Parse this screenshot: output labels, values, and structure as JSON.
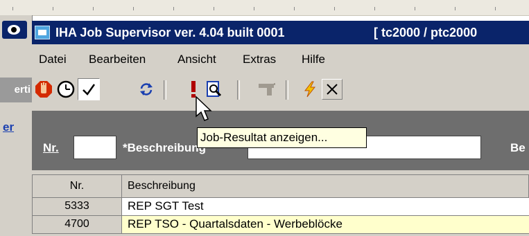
{
  "window": {
    "title": "IHA Job Supervisor ver. 4.04 built 0001",
    "server": "[ tc2000 / ptc2000"
  },
  "side_panel": {
    "gray_label": "erti",
    "link": "er"
  },
  "menu": [
    "Datei",
    "Bearbeiten",
    "Ansicht",
    "Extras",
    "Hilfe"
  ],
  "toolbar": {
    "buttons": [
      {
        "icon": "stop-hand-icon"
      },
      {
        "icon": "clock-icon"
      },
      {
        "icon": "checkmark-icon",
        "pressed": true
      },
      {
        "icon": "refresh-icon"
      },
      {
        "icon": "exclamation-icon"
      },
      {
        "icon": "preview-icon"
      },
      {
        "icon": "gun-icon",
        "disabled": true
      },
      {
        "icon": "lightning-icon"
      },
      {
        "icon": "cross-icon"
      }
    ]
  },
  "tooltip": "Job-Resultat anzeigen...",
  "filter": {
    "nr_label": "Nr.",
    "desc_label": "*Beschreibung",
    "right_label": "Be"
  },
  "grid": {
    "columns": [
      "Nr.",
      "Beschreibung"
    ],
    "rows": [
      {
        "nr": "5333",
        "desc": "REP SGT  Test"
      },
      {
        "nr": "4700",
        "desc": "REP TSO - Quartalsdaten - Werbeblöcke"
      }
    ]
  },
  "colors": {
    "titlebar": "#0a246a",
    "face": "#d4d0c8",
    "filter_bg": "#6e6e6e",
    "tooltip_bg": "#ffffe1",
    "row2_bg": "#ffffcc"
  }
}
